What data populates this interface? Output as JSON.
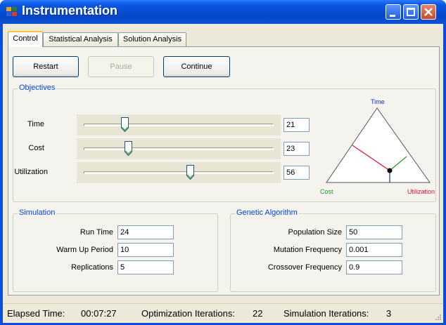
{
  "window": {
    "title": "Instrumentation"
  },
  "tabs": [
    {
      "label": "Control"
    },
    {
      "label": "Statistical Analysis"
    },
    {
      "label": "Solution Analysis"
    }
  ],
  "buttons": {
    "restart": "Restart",
    "pause": "Pause",
    "continue": "Continue"
  },
  "objectives": {
    "group_label": "Objectives",
    "rows": [
      {
        "label": "Time",
        "value": "21",
        "slider_fraction": 0.21
      },
      {
        "label": "Cost",
        "value": "23",
        "slider_fraction": 0.23
      },
      {
        "label": "Utilization",
        "value": "56",
        "slider_fraction": 0.56
      }
    ],
    "triangle": {
      "top_label": "Time",
      "left_label": "Cost",
      "right_label": "Utilization",
      "colors": {
        "time": "#1a2ad1",
        "cost": "#1e9a1e",
        "utilization": "#e0102c"
      }
    }
  },
  "simulation": {
    "group_label": "Simulation",
    "fields": [
      {
        "label": "Run Time",
        "value": "24"
      },
      {
        "label": "Warm Up Period",
        "value": "10"
      },
      {
        "label": "Replications",
        "value": "5"
      }
    ]
  },
  "genetic": {
    "group_label": "Genetic Algorithm",
    "fields": [
      {
        "label": "Population Size",
        "value": "50"
      },
      {
        "label": "Mutation Frequency",
        "value": "0.001"
      },
      {
        "label": "Crossover Frequency",
        "value": "0.9"
      }
    ]
  },
  "status": {
    "elapsed_label": "Elapsed Time:",
    "elapsed_value": "00:07:27",
    "opt_label": "Optimization Iterations:",
    "opt_value": "22",
    "sim_label": "Simulation Iterations:",
    "sim_value": "3"
  }
}
